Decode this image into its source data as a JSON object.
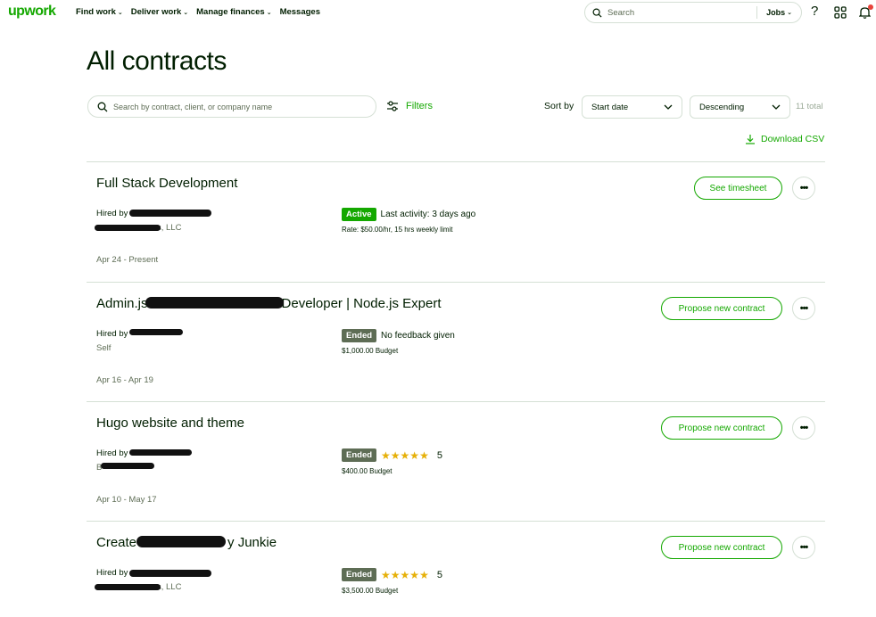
{
  "nav": {
    "logo": "upwork",
    "menu": [
      "Find work",
      "Deliver work",
      "Manage finances",
      "Messages"
    ],
    "search_placeholder": "Search",
    "search_scope": "Jobs",
    "help_glyph": "?",
    "colors": {
      "brand": "#14a800",
      "notification": "#e8433b"
    }
  },
  "page": {
    "title": "All contracts",
    "search_placeholder": "Search by contract, client, or company name",
    "filters_label": "Filters",
    "sort_label": "Sort by",
    "sort_field": "Start date",
    "sort_order": "Descending",
    "total": "11 total",
    "download_label": "Download CSV"
  },
  "icons": {
    "search": "search-icon",
    "filters": "sliders-icon",
    "download": "download-icon",
    "help": "question-icon",
    "apps": "grid-icon",
    "notifications": "bell-icon"
  },
  "contracts": [
    {
      "title": "Full Stack Development",
      "hired_by": "Hired by",
      "client": "s, LLC",
      "status": "Active",
      "status_text": "Last activity: 3 days ago",
      "detail": "Rate: $50.00/hr, 15 hrs weekly limit",
      "dates": "Apr 24 - Present",
      "action": "See timesheet",
      "more": "•••"
    },
    {
      "title_start": "Admin.js",
      "title_end": "Developer | Node.js Expert",
      "hired_by": "Hired by",
      "client": "Self",
      "status": "Ended",
      "status_text": "No feedback given",
      "detail": "$1,000.00 Budget",
      "dates": "Apr 16 - Apr 19",
      "action": "Propose new contract",
      "more": "•••"
    },
    {
      "title": "Hugo website and theme",
      "hired_by": "Hired by",
      "client": "B",
      "status": "Ended",
      "stars": "★★★★★",
      "rating": "5",
      "detail": "$400.00 Budget",
      "dates": "Apr 10 - May 17",
      "action": "Propose new contract",
      "more": "•••"
    },
    {
      "title_start": "Create",
      "title_end": "y Junkie",
      "hired_by": "Hired by",
      "client": "s, LLC",
      "status": "Ended",
      "stars": "★★★★★",
      "rating": "5",
      "detail": "$3,500.00 Budget",
      "action": "Propose new contract",
      "more": "•••"
    }
  ]
}
